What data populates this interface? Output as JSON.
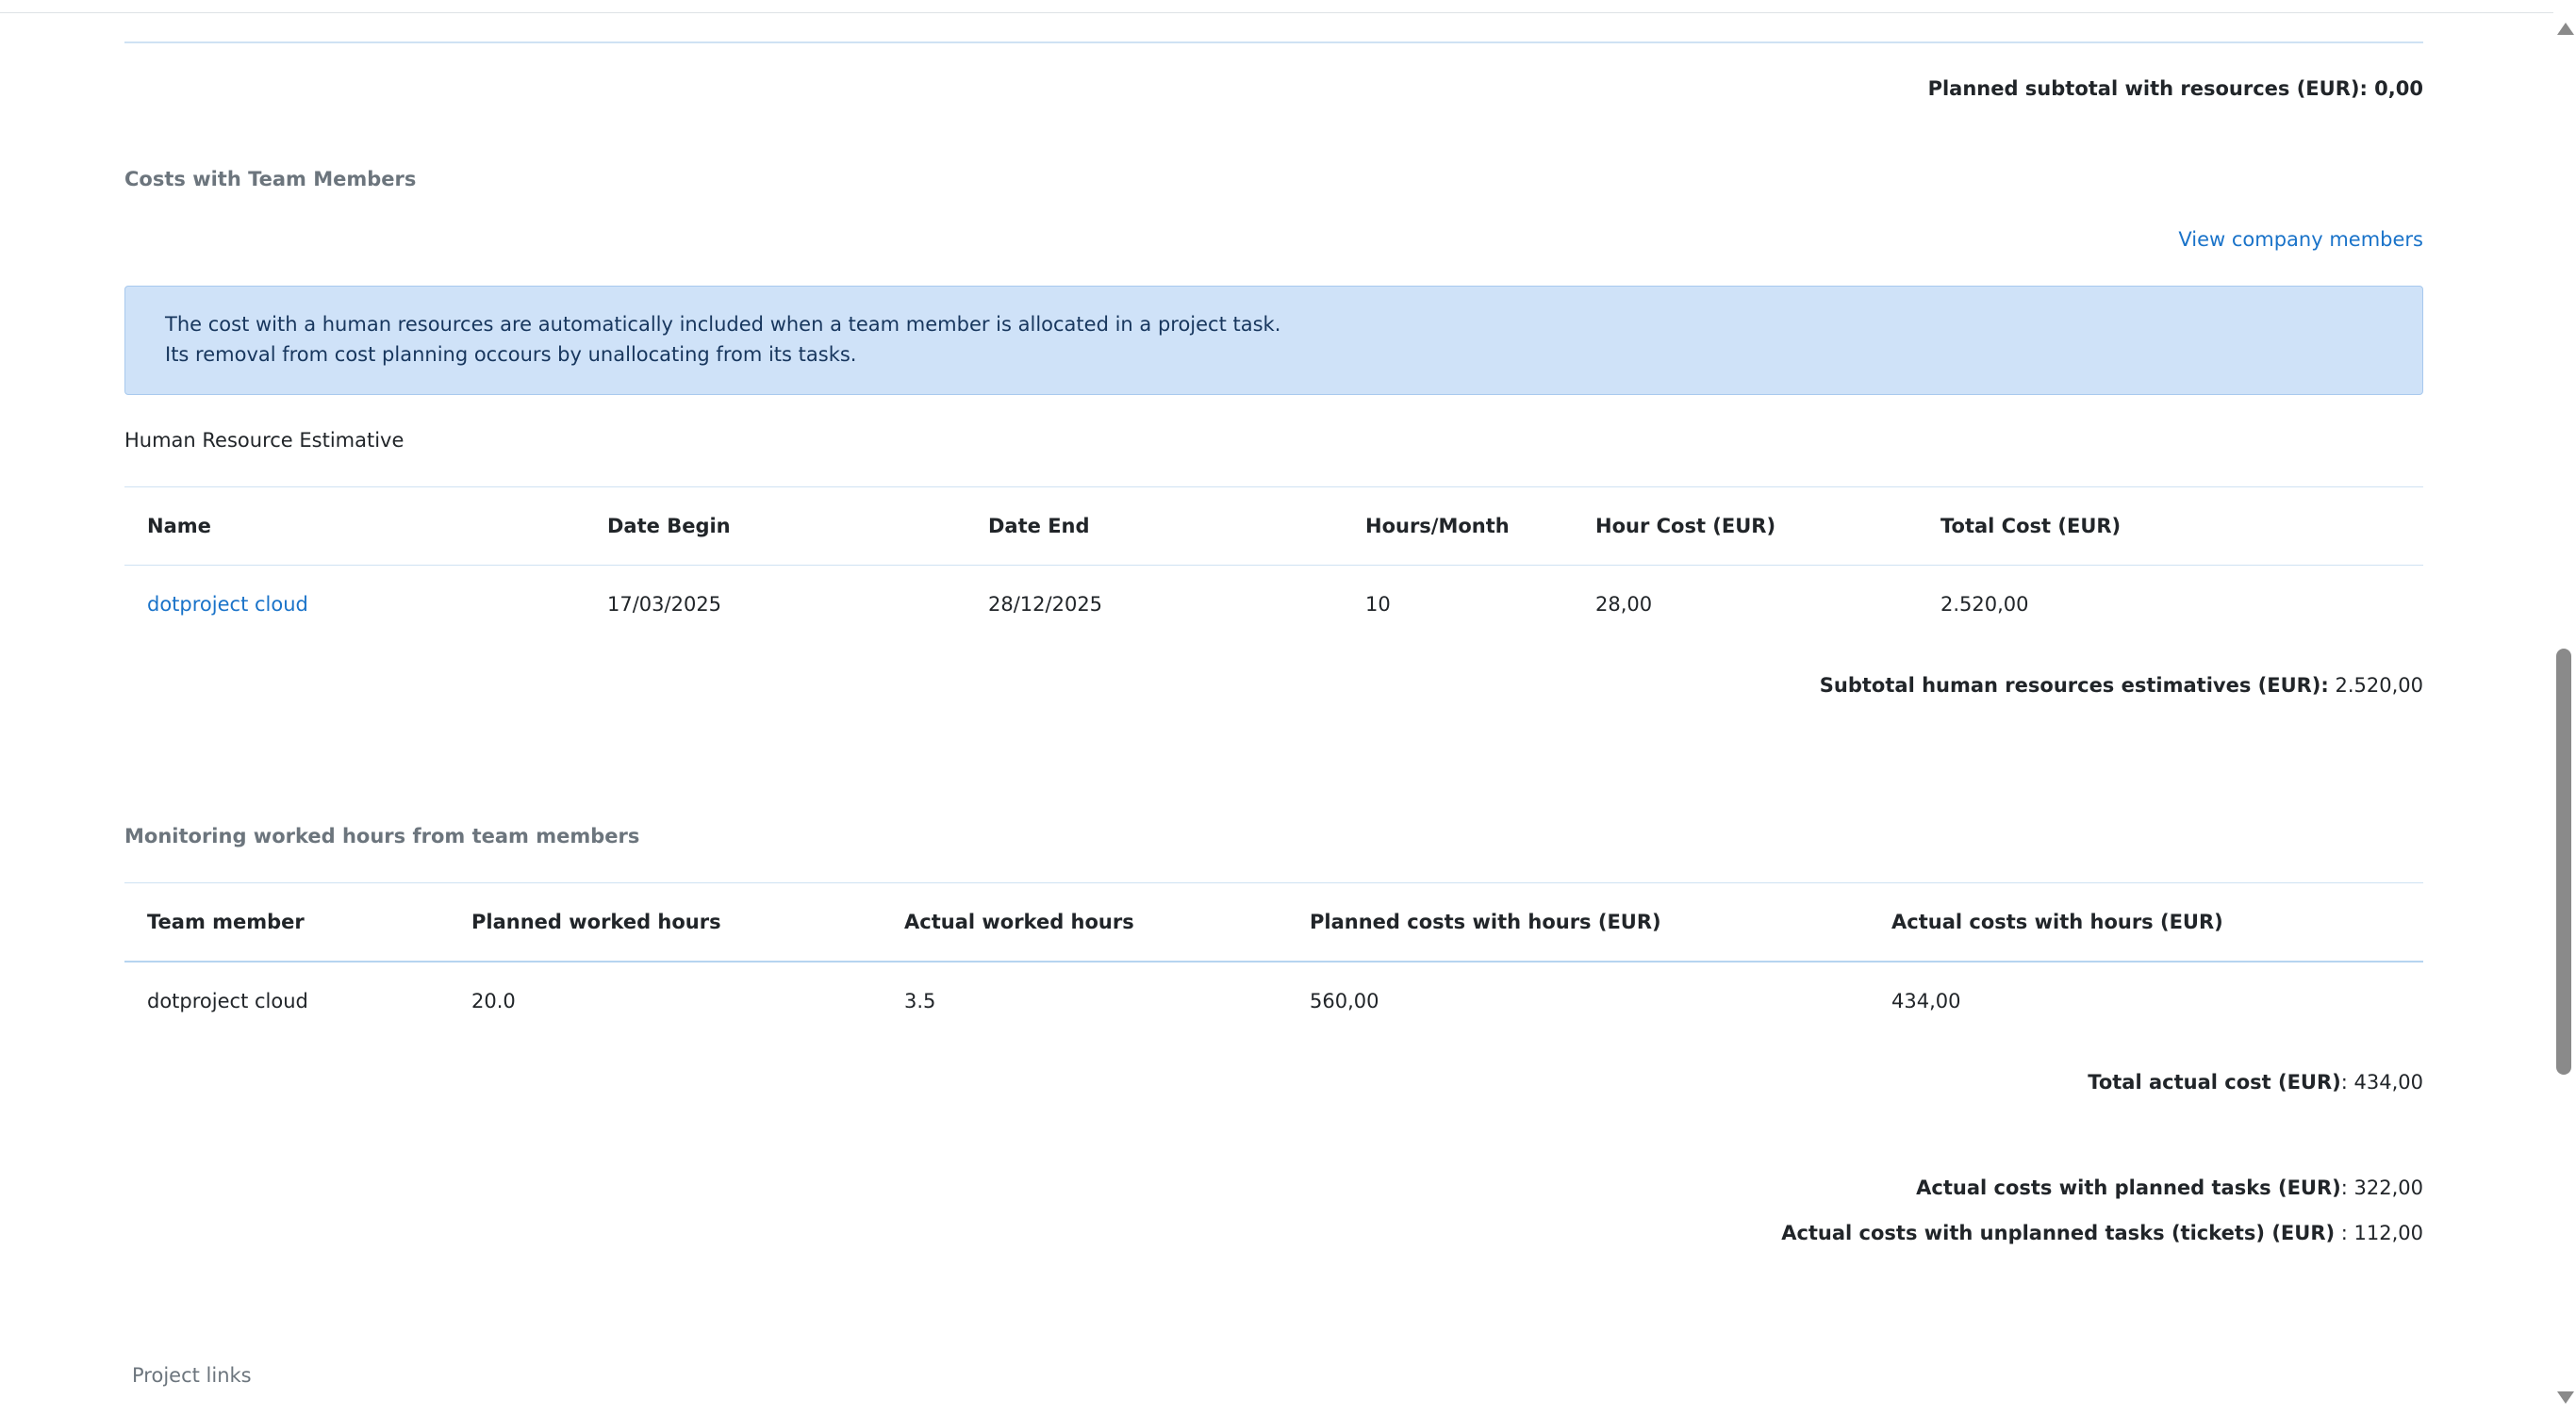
{
  "planned_subtotal_resources": {
    "label": "Planned subtotal with resources  (EUR): 0,00"
  },
  "team_costs": {
    "heading": "Costs with Team Members",
    "view_members_link": "View company members",
    "alert": {
      "line1": "The cost with a human resources are automatically included when a team member is allocated in a project task.",
      "line2": "Its removal from cost planning occours by unallocating from its tasks."
    },
    "estimative_label": "Human Resource Estimative",
    "table": {
      "headers": [
        "Name",
        "Date Begin",
        "Date End",
        "Hours/Month",
        "Hour Cost  (EUR)",
        "Total Cost (EUR)"
      ],
      "rows": [
        [
          "dotproject cloud",
          "17/03/2025",
          "28/12/2025",
          "10",
          "28,00",
          "2.520,00"
        ]
      ]
    },
    "subtotal": {
      "label": "Subtotal human resources estimatives  (EUR):",
      "value": " 2.520,00"
    }
  },
  "monitoring": {
    "heading": "Monitoring worked hours from team members",
    "table": {
      "headers": [
        "Team member",
        "Planned worked hours",
        "Actual worked hours",
        "Planned costs with hours  (EUR)",
        "Actual costs with hours  (EUR)"
      ],
      "rows": [
        [
          "dotproject cloud",
          "20.0",
          "3.5",
          "560,00",
          "434,00"
        ]
      ]
    },
    "total_actual": {
      "label": "Total actual cost  (EUR)",
      "value": ": 434,00"
    },
    "planned_tasks": {
      "label": "Actual costs with planned tasks (EUR)",
      "value": ": 322,00"
    },
    "unplanned_tasks": {
      "label": "Actual costs with unplanned tasks (tickets) (EUR)",
      "value": " : 112,00"
    }
  },
  "footer": {
    "project_links": "Project links"
  },
  "colors": {
    "link": "#1a73c9",
    "alert_bg": "#cfe2f8",
    "heading_gray": "#6c757d"
  }
}
